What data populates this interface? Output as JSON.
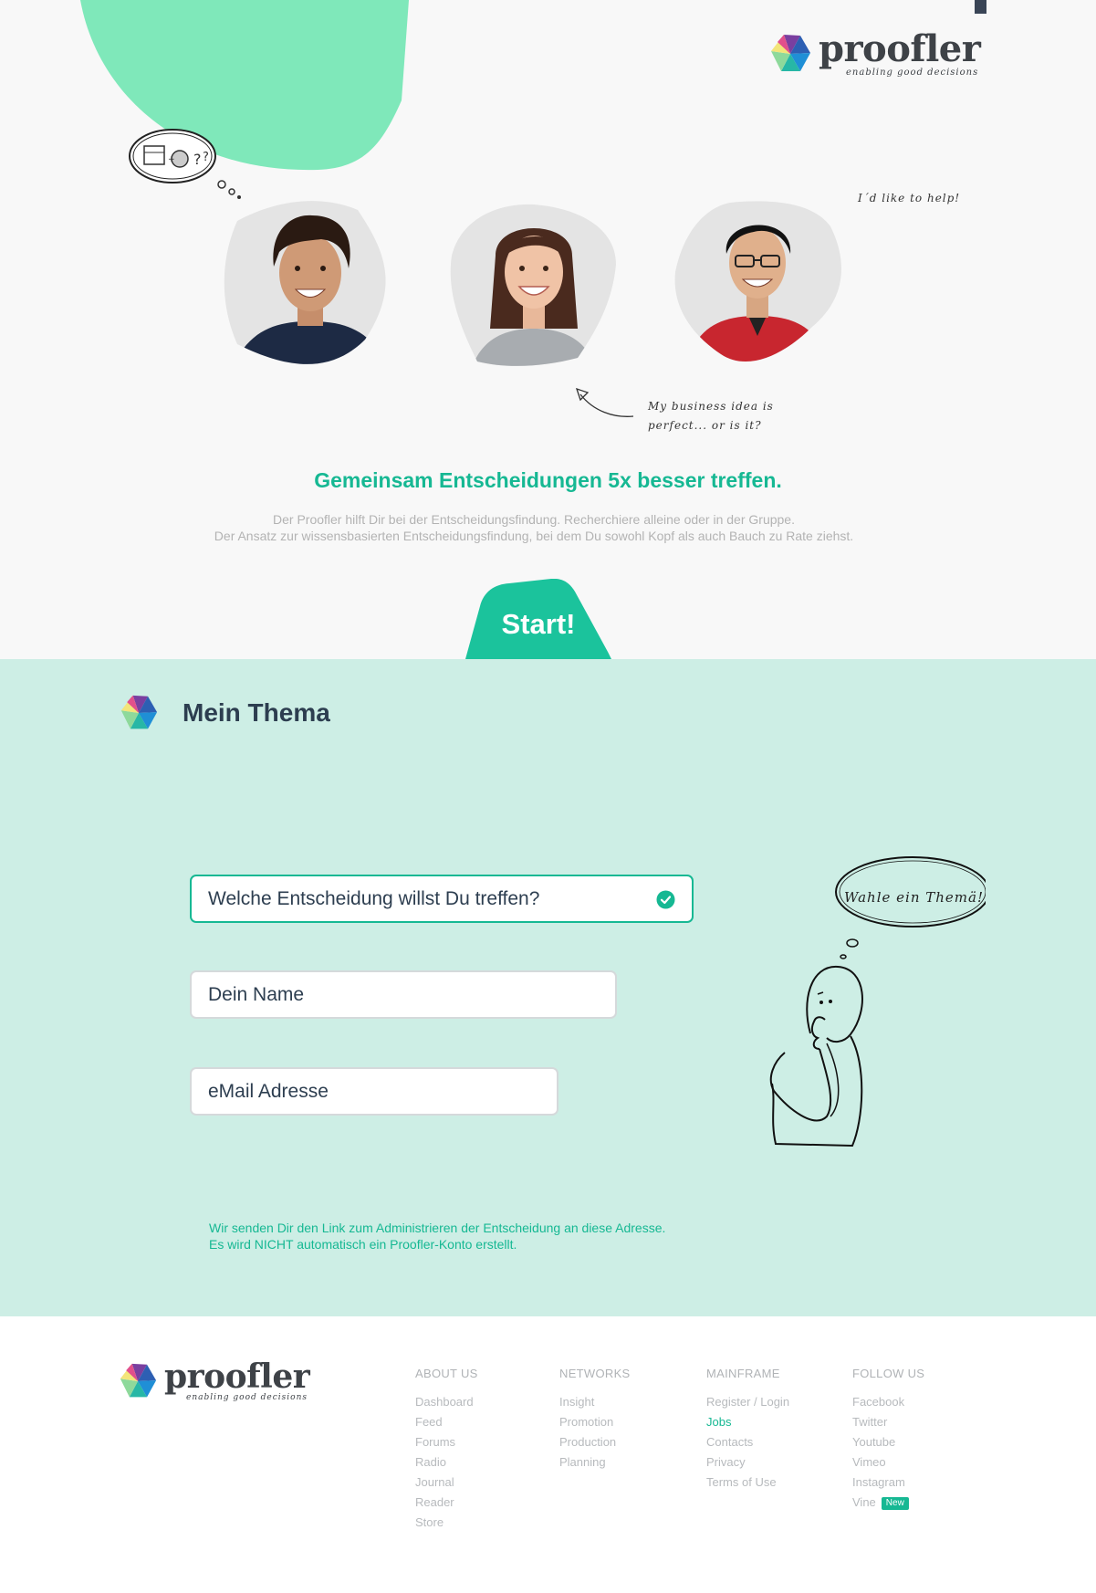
{
  "brand": {
    "name": "proofler",
    "tagline": "enabling good decisions"
  },
  "hero": {
    "note_help": "I´d like to help!",
    "note_idea_line1": "My business idea is",
    "note_idea_line2": "perfect... or is it?",
    "title": "Gemeinsam Entscheidungen 5x besser treffen.",
    "text_line1": "Der Proofler hilft Dir bei der Entscheidungsfindung. Recherchiere alleine oder in der Gruppe.",
    "text_line2": "Der Ansatz zur wissensbasierten Entscheidungsfindung, bei dem Du sowohl Kopf als auch Bauch zu Rate ziehst.",
    "start_label": "Start!"
  },
  "form": {
    "section_title": "Mein Thema",
    "decision_field": "Welche Entscheidung willst Du treffen?",
    "name_field": "Dein Name",
    "email_field": "eMail Adresse",
    "note_line1": "Wir senden Dir den Link zum Administrieren der Entscheidung an diese Adresse.",
    "note_line2": "Es wird NICHT automatisch ein Proofler-Konto erstellt.",
    "bubble_text": "Wahle ein Themä!"
  },
  "footer": {
    "columns": [
      {
        "heading": "ABOUT US",
        "links": [
          "Dashboard",
          "Feed",
          "Forums",
          "Radio",
          "Journal",
          "Reader",
          "Store"
        ]
      },
      {
        "heading": "NETWORKS",
        "links": [
          "Insight",
          "Promotion",
          "Production",
          "Planning"
        ]
      },
      {
        "heading": "MAINFRAME",
        "links": [
          "Register / Login",
          "Jobs",
          "Contacts",
          "Privacy",
          "Terms of Use"
        ]
      },
      {
        "heading": "FOLLOW US",
        "links": [
          "Facebook",
          "Twitter",
          "Youtube",
          "Vimeo",
          "Instagram",
          "Vine"
        ]
      }
    ],
    "new_badge": "New"
  },
  "colors": {
    "accent": "#16b893",
    "hero_bg": "#f8f8f8",
    "form_bg": "#cdeee5",
    "blob": "#7fe8ba",
    "title_dark": "#2d3e50"
  },
  "icons": [
    "proofler-logo-icon",
    "check-circle-icon",
    "thought-bubble-icon",
    "arrow-sketch-icon",
    "thinking-person-illustration"
  ]
}
